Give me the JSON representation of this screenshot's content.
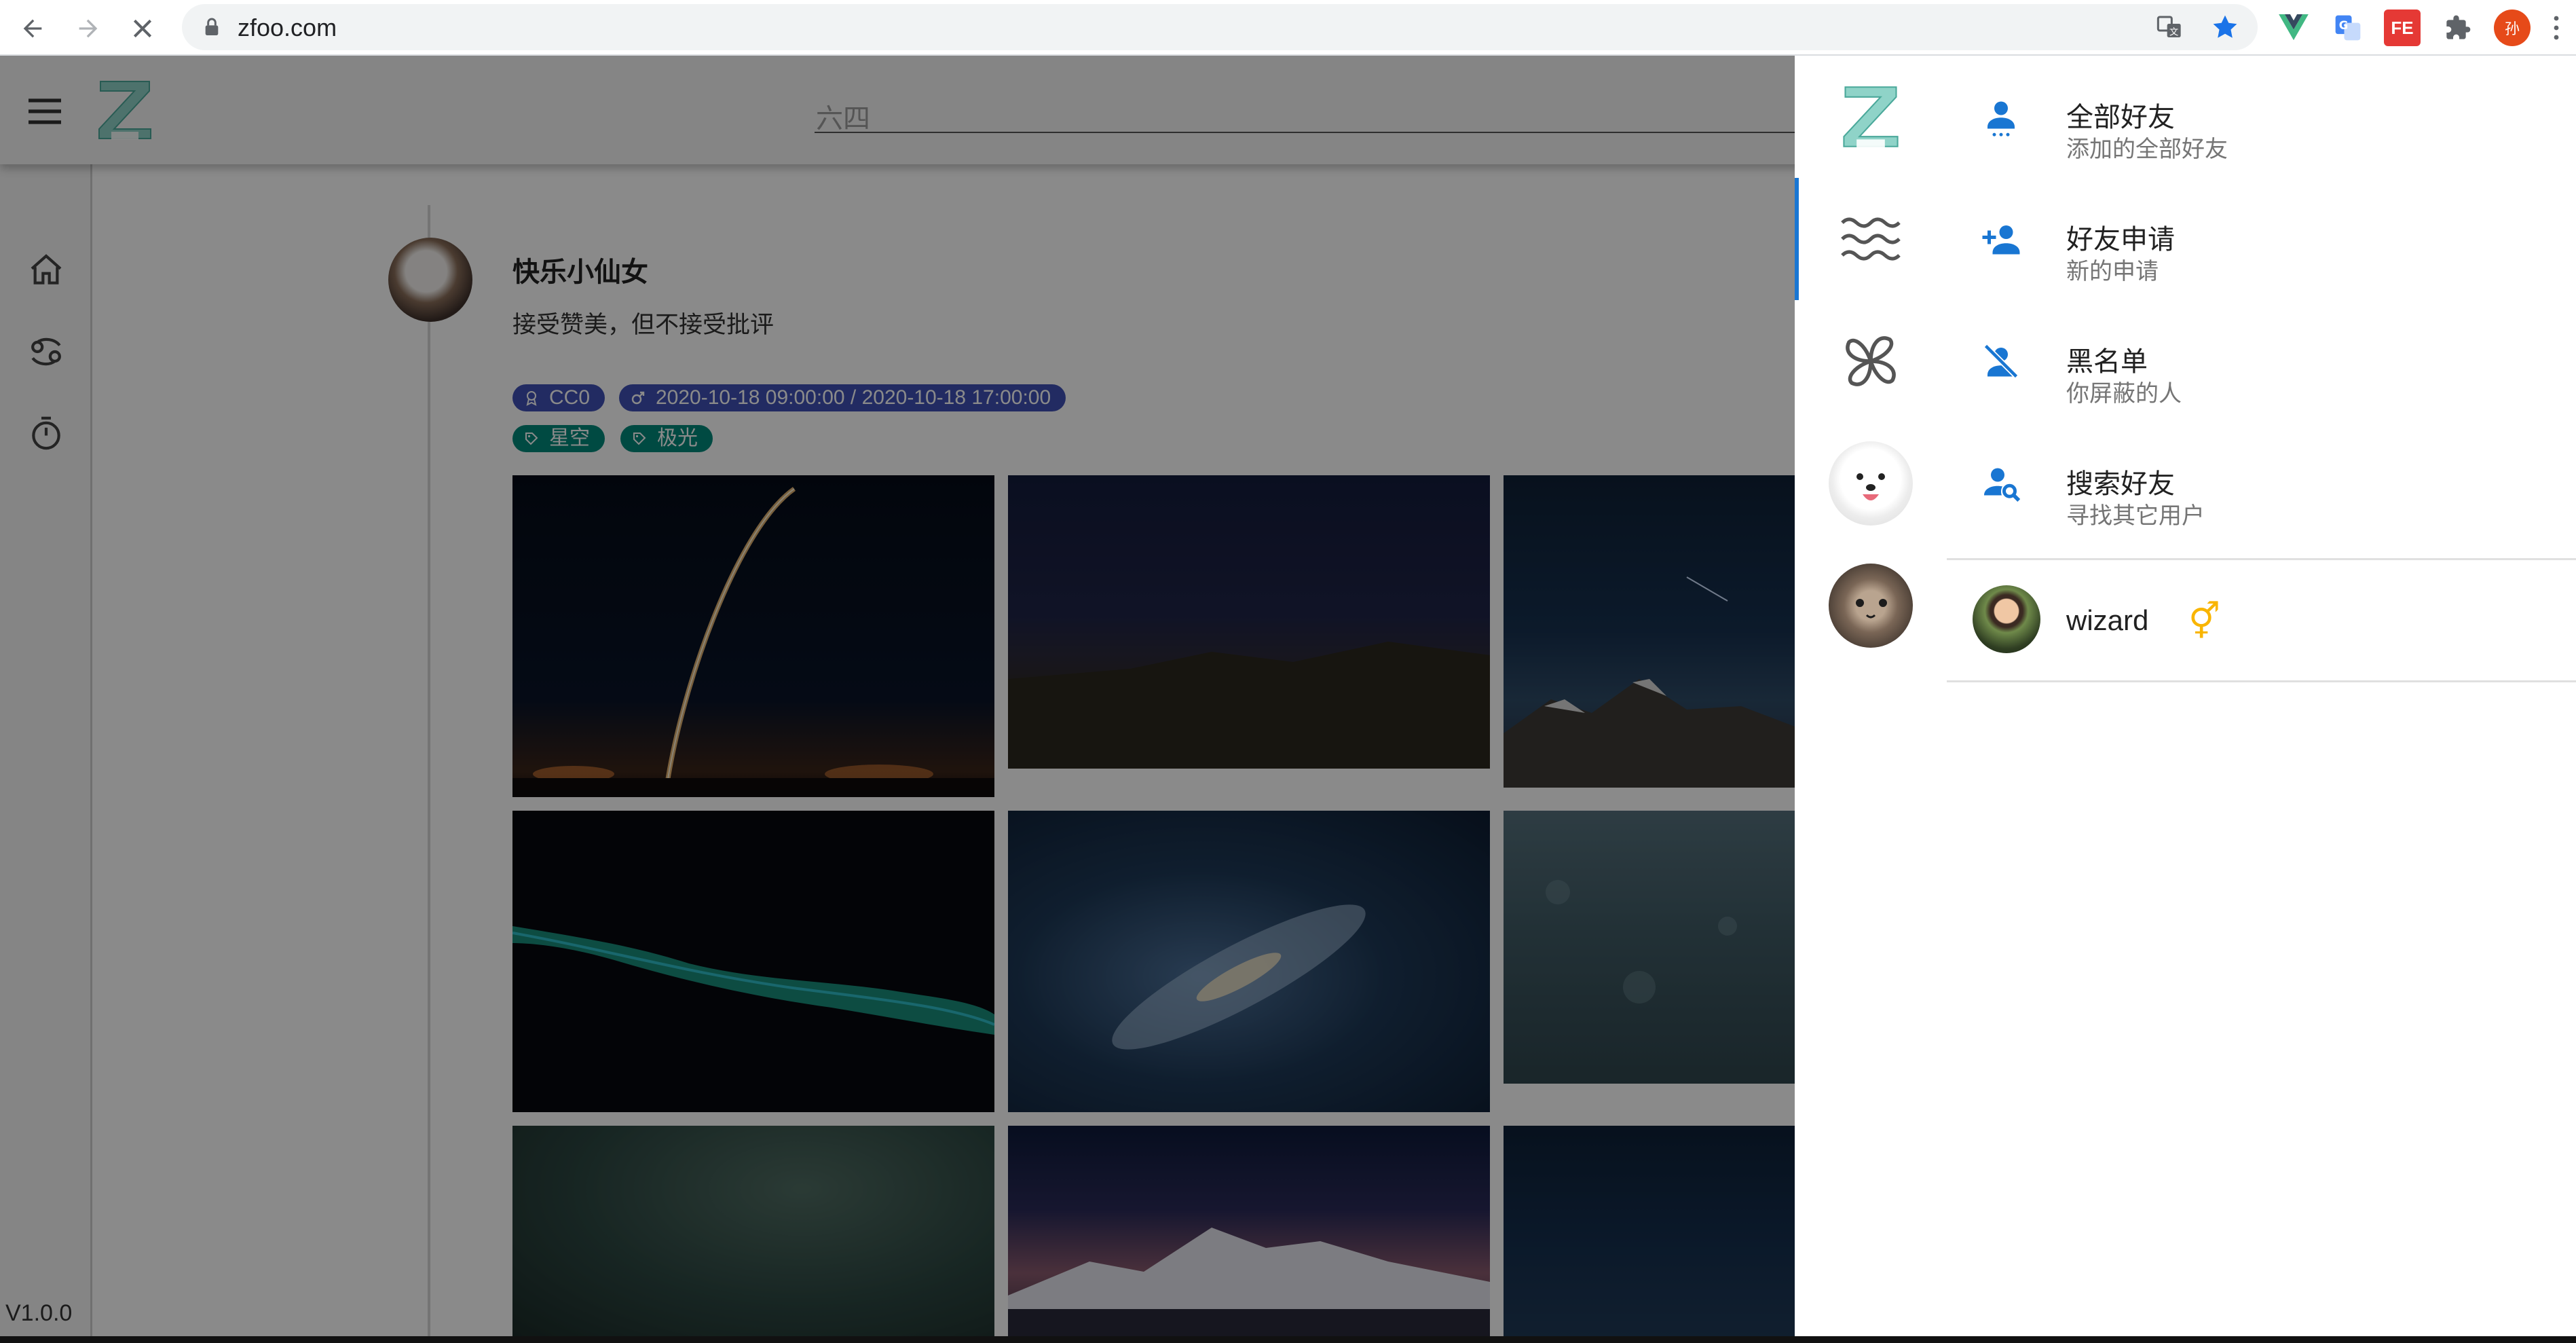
{
  "browser": {
    "url": "zfoo.com",
    "profile_initial": "孙"
  },
  "header": {
    "search_text": "六四"
  },
  "sidebar": {
    "version": "V1.0.0"
  },
  "post": {
    "author": "快乐小仙女",
    "text": "接受赞美，但不接受批评",
    "license_chip": "CC0",
    "time_chip": "2020-10-18 09:00:00 / 2020-10-18 17:00:00",
    "tags": [
      "星空",
      "极光"
    ]
  },
  "drawer": {
    "menu": [
      {
        "title": "全部好友",
        "subtitle": "添加的全部好友",
        "icon": "account-icon"
      },
      {
        "title": "好友申请",
        "subtitle": "新的申请",
        "icon": "account-plus-icon"
      },
      {
        "title": "黑名单",
        "subtitle": "你屏蔽的人",
        "icon": "account-off-icon"
      },
      {
        "title": "搜索好友",
        "subtitle": "寻找其它用户",
        "icon": "account-search-icon"
      }
    ],
    "friend": {
      "name": "wizard",
      "gender_symbol": "⚥"
    }
  },
  "colors": {
    "accent": "#1976d2",
    "chip_blue": "#3f51b5",
    "chip_teal": "#00897b",
    "gender": "#f9b500"
  }
}
